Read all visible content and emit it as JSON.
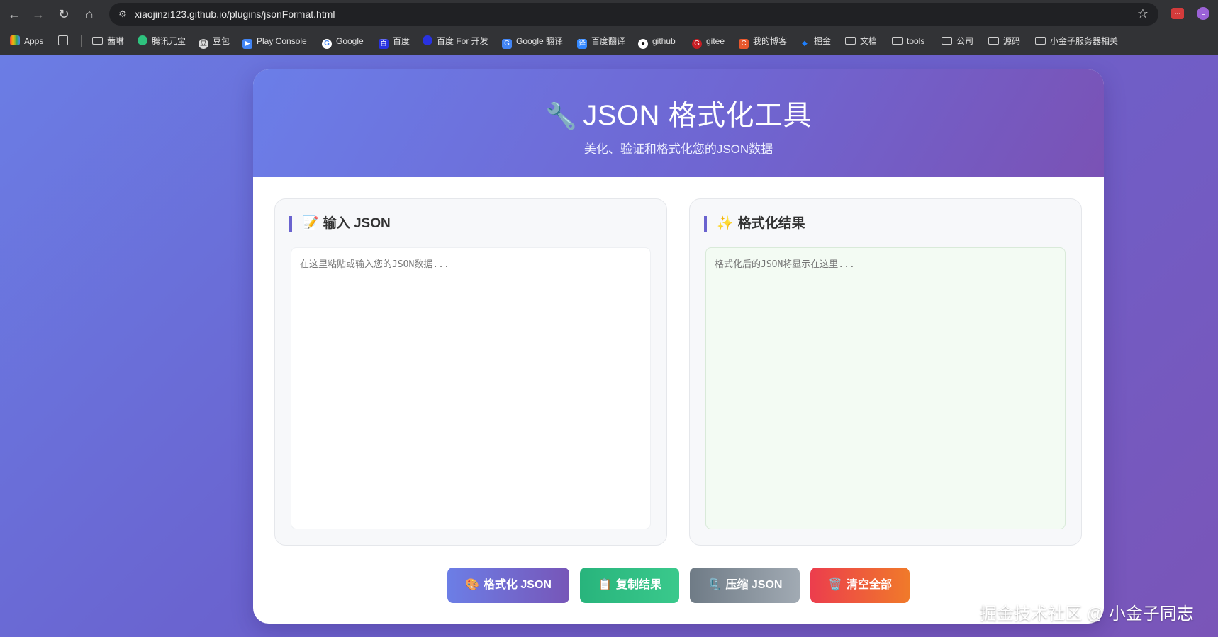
{
  "browser": {
    "url": "xiaojinzi123.github.io/plugins/jsonFormat.html",
    "nav_back": "←",
    "nav_forward": "→",
    "nav_reload": "↻",
    "nav_home": "⌂",
    "bookmarks": [
      {
        "label": "Apps",
        "icon": "apps-grid-icon"
      },
      {
        "label": "茜琳",
        "icon": "folder-icon"
      },
      {
        "label": "腾讯元宝",
        "icon": "yuanbao-icon"
      },
      {
        "label": "豆包",
        "icon": "doubao-icon"
      },
      {
        "label": "Play Console",
        "icon": "play-console-icon"
      },
      {
        "label": "Google",
        "icon": "google-icon"
      },
      {
        "label": "百度",
        "icon": "baidu-icon"
      },
      {
        "label": "百度 For 开发",
        "icon": "baidu-dev-icon"
      },
      {
        "label": "Google 翻译",
        "icon": "google-translate-icon"
      },
      {
        "label": "百度翻译",
        "icon": "baidu-translate-icon"
      },
      {
        "label": "github",
        "icon": "github-icon"
      },
      {
        "label": "gitee",
        "icon": "gitee-icon"
      },
      {
        "label": "我的博客",
        "icon": "blog-icon"
      },
      {
        "label": "掘金",
        "icon": "juejin-icon"
      },
      {
        "label": "文档",
        "icon": "folder-icon"
      },
      {
        "label": "tools",
        "icon": "folder-icon"
      },
      {
        "label": "公司",
        "icon": "folder-icon"
      },
      {
        "label": "源码",
        "icon": "folder-icon"
      },
      {
        "label": "小金子服务器相关",
        "icon": "folder-icon"
      }
    ]
  },
  "header": {
    "icon": "🔧",
    "title": "JSON 格式化工具",
    "subtitle": "美化、验证和格式化您的JSON数据"
  },
  "input_panel": {
    "emoji": "📝",
    "title": "输入 JSON",
    "placeholder": "在这里粘贴或输入您的JSON数据..."
  },
  "output_panel": {
    "emoji": "✨",
    "title": "格式化结果",
    "placeholder": "格式化后的JSON将显示在这里..."
  },
  "buttons": {
    "format": {
      "emoji": "🎨",
      "label": "格式化 JSON"
    },
    "copy": {
      "emoji": "📋",
      "label": "复制结果"
    },
    "compress": {
      "emoji": "🗜️",
      "label": "压缩 JSON"
    },
    "clear": {
      "emoji": "🗑️",
      "label": "清空全部"
    }
  },
  "watermark": "掘金技术社区 @ 小金子同志",
  "colors": {
    "accent": "#6a63cf",
    "copy_green": "#28b47c",
    "clear_red": "#ec3d4d"
  }
}
